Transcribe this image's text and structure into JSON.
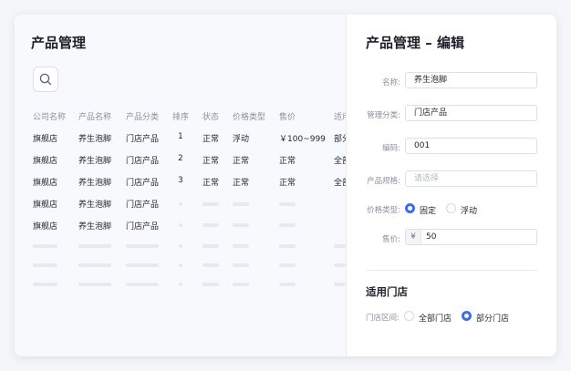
{
  "list": {
    "title": "产品管理",
    "search_icon": "search-icon",
    "columns": [
      "公司名称",
      "产品名称",
      "产品分类",
      "排序",
      "状态",
      "价格类型",
      "售价",
      "适用"
    ],
    "rows": [
      [
        "旗舰店",
        "养生泡脚",
        "门店产品",
        "1",
        "正常",
        "浮动",
        "￥100~999",
        "部分"
      ],
      [
        "旗舰店",
        "养生泡脚",
        "门店产品",
        "2",
        "正常",
        "正常",
        "正常",
        "全部"
      ],
      [
        "旗舰店",
        "养生泡脚",
        "门店产品",
        "3",
        "正常",
        "正常",
        "正常",
        "全部"
      ],
      [
        "旗舰店",
        "养生泡脚",
        "门店产品"
      ],
      [
        "旗舰店",
        "养生泡脚",
        "门店产品"
      ]
    ]
  },
  "edit": {
    "title": "产品管理 – 编辑",
    "fields": {
      "name": {
        "label": "名称:",
        "value": "养生泡脚"
      },
      "category": {
        "label": "管理分类:",
        "value": "门店产品"
      },
      "code": {
        "label": "编码:",
        "value": "001"
      },
      "spec": {
        "label": "产品规格:",
        "placeholder": "请选择"
      },
      "price_type": {
        "label": "价格类型:",
        "options": [
          "固定",
          "浮动"
        ],
        "selected": "固定"
      },
      "price": {
        "label": "售价:",
        "prefix": "¥",
        "value": "50"
      }
    },
    "stores": {
      "title": "适用门店",
      "label": "门店区间:",
      "options": [
        "全部门店",
        "部分门店"
      ],
      "selected": "部分门店"
    }
  },
  "colors": {
    "accent": "#3d6cf0",
    "muted": "#8a909c",
    "placeholder": "#e6e9ee"
  }
}
